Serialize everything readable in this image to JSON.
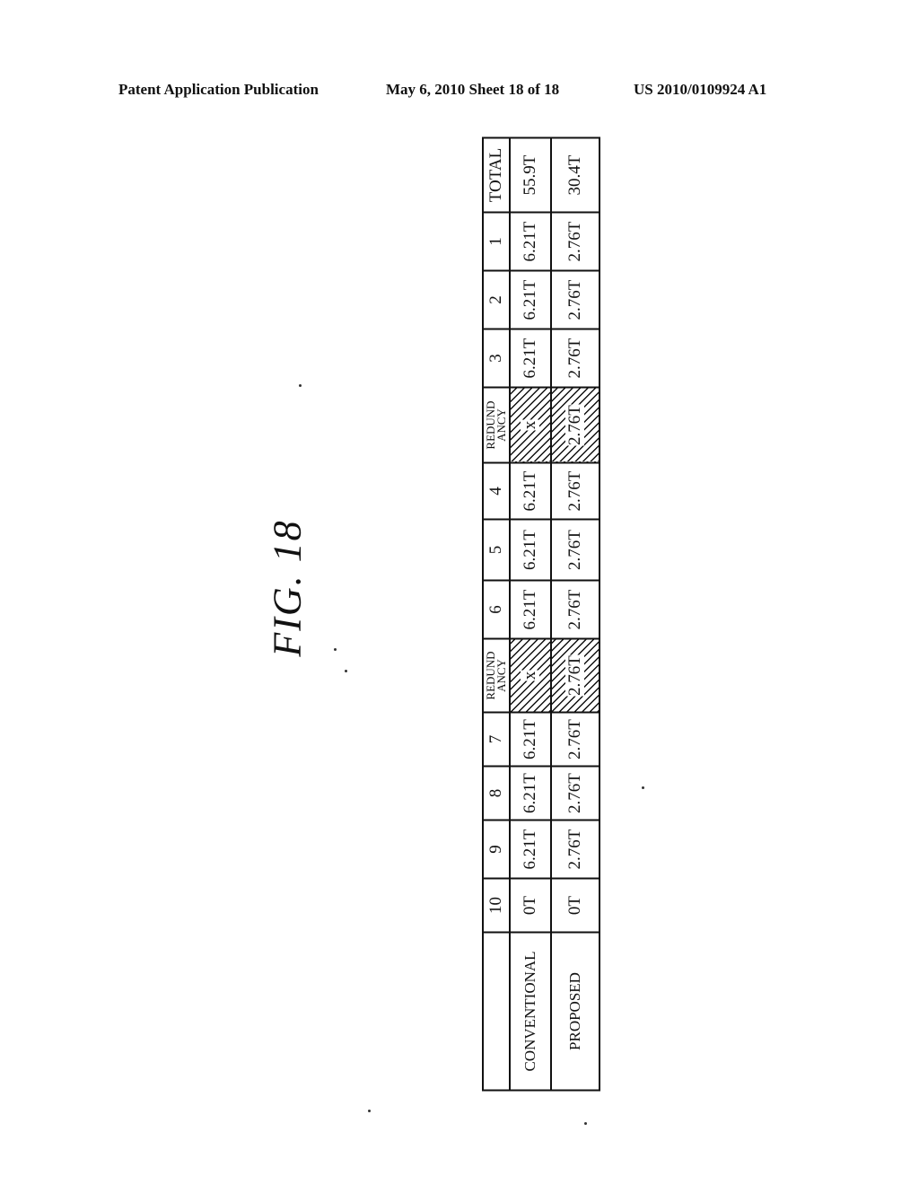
{
  "header": {
    "left": "Patent Application Publication",
    "middle": "May 6, 2010   Sheet 18 of 18",
    "right": "US 2010/0109924 A1"
  },
  "figure_label": "FIG. 18",
  "table": {
    "columns": [
      "",
      "10",
      "9",
      "8",
      "7",
      "REDUND ANCY",
      "6",
      "5",
      "4",
      "REDUND ANCY",
      "3",
      "2",
      "1",
      "TOTAL"
    ],
    "rows": [
      {
        "label": "CONVENTIONAL",
        "cells": [
          "0T",
          "6.21T",
          "6.21T",
          "6.21T",
          "x",
          "6.21T",
          "6.21T",
          "6.21T",
          "x",
          "6.21T",
          "6.21T",
          "6.21T",
          "55.9T"
        ]
      },
      {
        "label": "PROPOSED",
        "cells": [
          "0T",
          "2.76T",
          "2.76T",
          "2.76T",
          "2.76T",
          "2.76T",
          "2.76T",
          "2.76T",
          "2.76T",
          "2.76T",
          "2.76T",
          "2.76T",
          "30.4T"
        ]
      }
    ],
    "hatched_columns": [
      5,
      9
    ]
  }
}
